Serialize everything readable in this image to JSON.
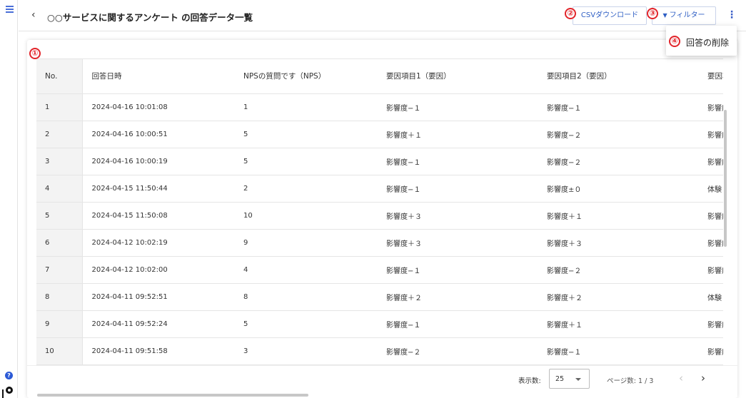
{
  "header": {
    "back_glyph": "‹",
    "title": "○○サービスに関するアンケート の回答データ一覧",
    "csv_button": "CSVダウンロード",
    "filter_button": "フィルター",
    "filter_icon": "▼",
    "more_icon": "⋮"
  },
  "menu": {
    "delete_item": "回答の削除"
  },
  "markers": [
    "①",
    "②",
    "③",
    "④"
  ],
  "table": {
    "columns": [
      "No.",
      "回答日時",
      "NPSの質問です（NPS）",
      "要因項目1（要因）",
      "要因項目2（要因）",
      "要因項"
    ],
    "rows": [
      [
        "1",
        "2024-04-16 10:01:08",
        "1",
        "影響度−１",
        "影響度−１",
        "影響度"
      ],
      [
        "2",
        "2024-04-16 10:00:51",
        "5",
        "影響度＋１",
        "影響度−２",
        "影響度"
      ],
      [
        "3",
        "2024-04-16 10:00:19",
        "5",
        "影響度−１",
        "影響度−２",
        "影響度"
      ],
      [
        "4",
        "2024-04-15 11:50:44",
        "2",
        "影響度−１",
        "影響度±０",
        "体験し"
      ],
      [
        "5",
        "2024-04-15 11:50:08",
        "10",
        "影響度＋３",
        "影響度＋１",
        "影響度"
      ],
      [
        "6",
        "2024-04-12 10:02:19",
        "9",
        "影響度＋３",
        "影響度＋３",
        "影響度"
      ],
      [
        "7",
        "2024-04-12 10:02:00",
        "4",
        "影響度−１",
        "影響度−２",
        "影響度"
      ],
      [
        "8",
        "2024-04-11 09:52:51",
        "8",
        "影響度＋２",
        "影響度＋２",
        "体験し"
      ],
      [
        "9",
        "2024-04-11 09:52:24",
        "5",
        "影響度−１",
        "影響度＋１",
        "影響度"
      ],
      [
        "10",
        "2024-04-11 09:51:58",
        "3",
        "影響度−２",
        "影響度−１",
        "影響度"
      ]
    ]
  },
  "pagination": {
    "per_page_label": "表示数:",
    "per_page_value": "25",
    "page_info": "ページ数: 1 / 3",
    "prev_glyph": "‹",
    "next_glyph": "›"
  },
  "rail": {
    "help_glyph": "?"
  },
  "colors": {
    "accent": "#2f5fc4",
    "marker": "#e2242a"
  }
}
